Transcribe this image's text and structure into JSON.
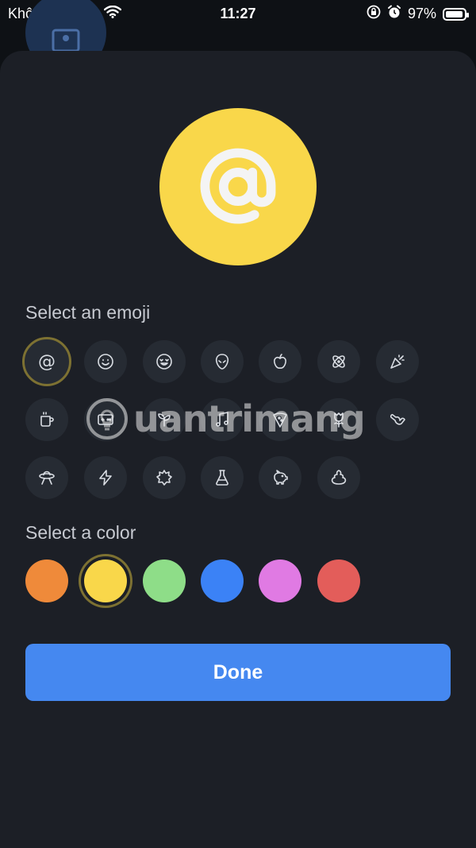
{
  "status_bar": {
    "carrier": "Không có SIM",
    "time": "11:27",
    "battery": "97%",
    "battery_level": 0.97
  },
  "preview": {
    "symbol": "@",
    "color": "#f9d74a"
  },
  "emoji_section": {
    "label": "Select an emoji",
    "items": [
      {
        "icon": "at-sign-icon",
        "symbol": "@",
        "selected": true
      },
      {
        "icon": "smiley-face-icon"
      },
      {
        "icon": "heart-eyes-face-icon"
      },
      {
        "icon": "alien-icon"
      },
      {
        "icon": "apple-icon"
      },
      {
        "icon": "atom-icon"
      },
      {
        "icon": "party-popper-icon"
      },
      {
        "icon": "coffee-mug-icon"
      },
      {
        "icon": "game-console-icon"
      },
      {
        "icon": "sprout-icon"
      },
      {
        "icon": "music-note-icon"
      },
      {
        "icon": "pizza-slice-icon"
      },
      {
        "icon": "tulip-icon"
      },
      {
        "icon": "shaka-hand-icon"
      },
      {
        "icon": "ufo-icon"
      },
      {
        "icon": "lightning-bolt-icon"
      },
      {
        "icon": "burst-badge-icon"
      },
      {
        "icon": "flask-icon"
      },
      {
        "icon": "piggy-bank-icon"
      },
      {
        "icon": "poop-icon"
      }
    ]
  },
  "color_section": {
    "label": "Select a color",
    "colors": [
      {
        "name": "orange",
        "hex": "#ef8a3a"
      },
      {
        "name": "yellow",
        "hex": "#f9d74a",
        "selected": true
      },
      {
        "name": "green",
        "hex": "#8edd88"
      },
      {
        "name": "blue",
        "hex": "#3b82f6"
      },
      {
        "name": "pink",
        "hex": "#e07ae3"
      },
      {
        "name": "red",
        "hex": "#e35d5a"
      }
    ]
  },
  "done_button": {
    "label": "Done"
  },
  "watermark": {
    "text": "uantrimang"
  }
}
